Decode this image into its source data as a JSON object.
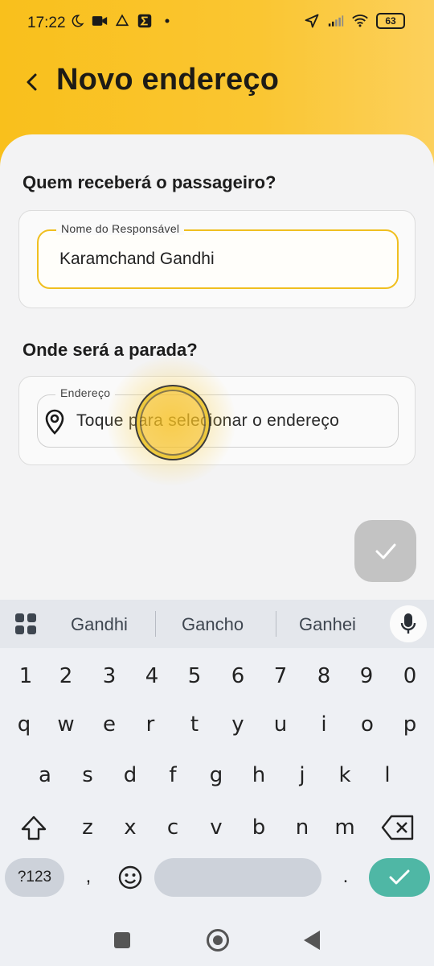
{
  "status_bar": {
    "time": "17:22",
    "battery": "63"
  },
  "header": {
    "title": "Novo endereço"
  },
  "receiver_section": {
    "title": "Quem receberá o passageiro?",
    "name_field": {
      "label": "Nome do Responsável",
      "value": "Karamchand Gandhi"
    }
  },
  "stop_section": {
    "title": "Onde será a parada?",
    "address_field": {
      "label": "Endereço",
      "placeholder": "Toque para selecionar o endereço"
    }
  },
  "keyboard": {
    "suggestions": [
      "Gandhi",
      "Gancho",
      "Ganhei"
    ],
    "number_row": [
      "1",
      "2",
      "3",
      "4",
      "5",
      "6",
      "7",
      "8",
      "9",
      "0"
    ],
    "row1": [
      "q",
      "w",
      "e",
      "r",
      "t",
      "y",
      "u",
      "i",
      "o",
      "p"
    ],
    "row2": [
      "a",
      "s",
      "d",
      "f",
      "g",
      "h",
      "j",
      "k",
      "l"
    ],
    "row3": [
      "z",
      "x",
      "c",
      "v",
      "b",
      "n",
      "m"
    ],
    "symbols_key": "?123",
    "comma_key": ",",
    "period_key": "."
  },
  "colors": {
    "accent": "#F9C01C",
    "enter": "#4FB7A5",
    "fab_disabled": "#C3C3C3"
  }
}
